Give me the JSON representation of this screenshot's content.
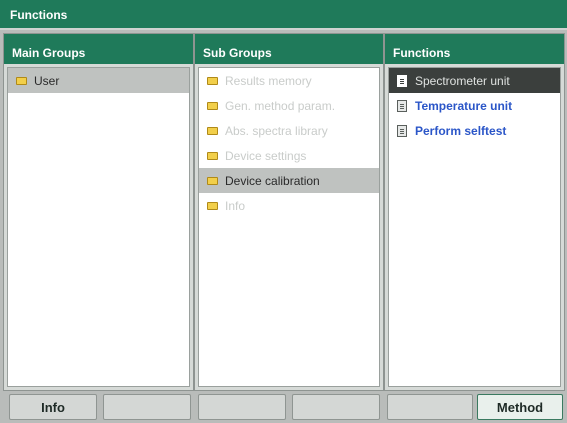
{
  "title": "Functions",
  "panels": {
    "main": {
      "header": "Main Groups",
      "items": [
        {
          "label": "User",
          "icon": "folder-icon",
          "state": "selected"
        }
      ]
    },
    "sub": {
      "header": "Sub Groups",
      "items": [
        {
          "label": "Results memory",
          "icon": "folder-icon",
          "state": "disabled"
        },
        {
          "label": "Gen. method param.",
          "icon": "folder-icon",
          "state": "disabled"
        },
        {
          "label": "Abs. spectra library",
          "icon": "folder-icon",
          "state": "disabled"
        },
        {
          "label": "Device settings",
          "icon": "folder-icon",
          "state": "disabled"
        },
        {
          "label": "Device calibration",
          "icon": "folder-icon",
          "state": "selected"
        },
        {
          "label": "Info",
          "icon": "folder-icon",
          "state": "disabled"
        }
      ]
    },
    "functions": {
      "header": "Functions",
      "items": [
        {
          "label": "Spectrometer unit",
          "icon": "document-icon",
          "state": "highlighted"
        },
        {
          "label": "Temperature unit",
          "icon": "document-icon",
          "state": "link"
        },
        {
          "label": "Perform selftest",
          "icon": "document-icon",
          "state": "link"
        }
      ]
    }
  },
  "softkeys": [
    "Info",
    "",
    "",
    "",
    "",
    "Method"
  ],
  "colors": {
    "header_green": "#1f7a5a",
    "link_blue": "#2b56c8",
    "highlight_dark": "#3b3f3d",
    "selection_gray": "#bfc2c0"
  }
}
